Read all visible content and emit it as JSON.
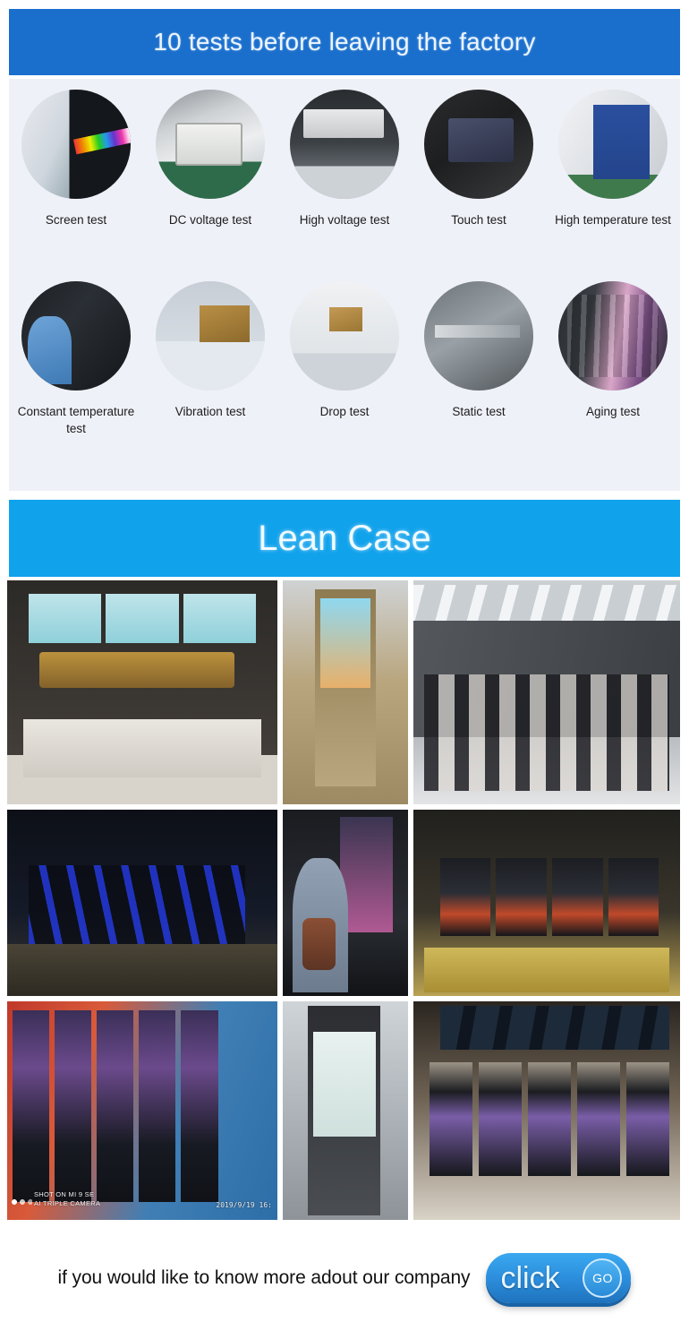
{
  "tests_section": {
    "banner_title": "10 tests before leaving the factory",
    "banner_color": "#1a6fcd",
    "background_color": "#eff1f8",
    "items": [
      {
        "label": "Screen test",
        "photo": "screen-test-photo"
      },
      {
        "label": "DC voltage test",
        "photo": "dc-voltage-test-photo"
      },
      {
        "label": "High voltage test",
        "photo": "high-voltage-test-photo"
      },
      {
        "label": "Touch test",
        "photo": "touch-test-photo"
      },
      {
        "label": "High temperature test",
        "photo": "high-temperature-test-photo"
      },
      {
        "label": "Constant temperature test",
        "photo": "constant-temperature-test-photo"
      },
      {
        "label": "Vibration test",
        "photo": "vibration-test-photo"
      },
      {
        "label": "Drop test",
        "photo": "drop-test-photo"
      },
      {
        "label": "Static test",
        "photo": "static-test-photo"
      },
      {
        "label": "Aging test",
        "photo": "aging-test-photo"
      }
    ]
  },
  "case_section": {
    "banner_title": "Lean Case",
    "banner_color": "#11a2ec",
    "photos": [
      {
        "name": "cinema-ticketing-kiosks",
        "caption": ""
      },
      {
        "name": "mcdonalds-ordering-kiosk",
        "caption": ""
      },
      {
        "name": "mall-self-service-kiosk-wall",
        "caption": ""
      },
      {
        "name": "blue-lit-kiosk-counter",
        "caption": ""
      },
      {
        "name": "woman-using-kiosk",
        "caption": ""
      },
      {
        "name": "gold-frame-kiosk-row",
        "caption": ""
      },
      {
        "name": "mural-wall-kiosk-row",
        "caption": ""
      },
      {
        "name": "station-payment-kiosk",
        "caption": ""
      },
      {
        "name": "corridor-kiosk-row",
        "caption": ""
      }
    ],
    "watermark": {
      "line1": "SHOT ON MI 9 SE",
      "line2": "AI TRIPLE CAMERA",
      "timestamp": "2019/9/19  16:"
    }
  },
  "footer": {
    "text": "if you would like to know more adout our company",
    "button_label": "click",
    "badge_label": "GO",
    "button_color": "#2b8ddc"
  }
}
